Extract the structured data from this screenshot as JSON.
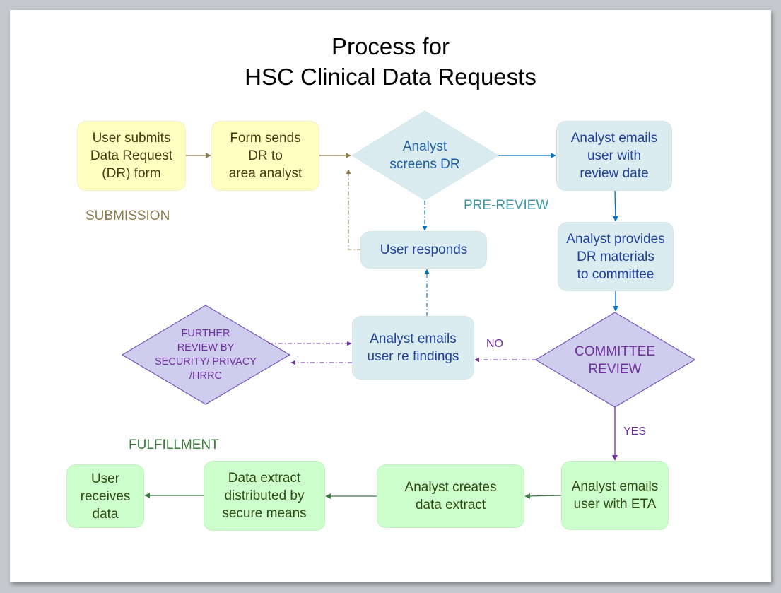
{
  "title": {
    "line1": "Process for",
    "line2": "HSC Clinical Data Requests"
  },
  "phases": {
    "submission": "SUBMISSION",
    "pre_review": "PRE-REVIEW",
    "fulfillment": "FULFILLMENT"
  },
  "colors": {
    "submission": "#8c7a4a",
    "pre_review": "#3a9aa8",
    "fulfillment": "#3a7a3a",
    "review": "#7030a0",
    "connector_blue": "#0070c0",
    "connector_tan": "#8c7a4a",
    "connector_green": "#3e7a46"
  },
  "nodes": {
    "user_submits": "User submits\nData Request\n(DR) form",
    "form_sends": "Form sends\nDR to\narea analyst",
    "analyst_screens": "Analyst\nscreens DR",
    "emails_review_date": "Analyst emails\nuser with\nreview date",
    "user_responds": "User responds",
    "provides_materials": "Analyst provides\nDR materials\nto committee",
    "committee_review": "COMMITTEE\nREVIEW",
    "emails_findings": "Analyst emails\nuser re findings",
    "further_review": "FURTHER\nREVIEW BY\nSECURITY/  PRIVACY\n/HRRC",
    "emails_eta": "Analyst emails\nuser with ETA",
    "creates_extract": "Analyst creates\ndata extract",
    "extract_distributed": "Data extract\ndistributed by\nsecure means",
    "user_receives": "User\nreceives\ndata"
  },
  "edge_labels": {
    "no": "NO",
    "yes": "YES"
  }
}
